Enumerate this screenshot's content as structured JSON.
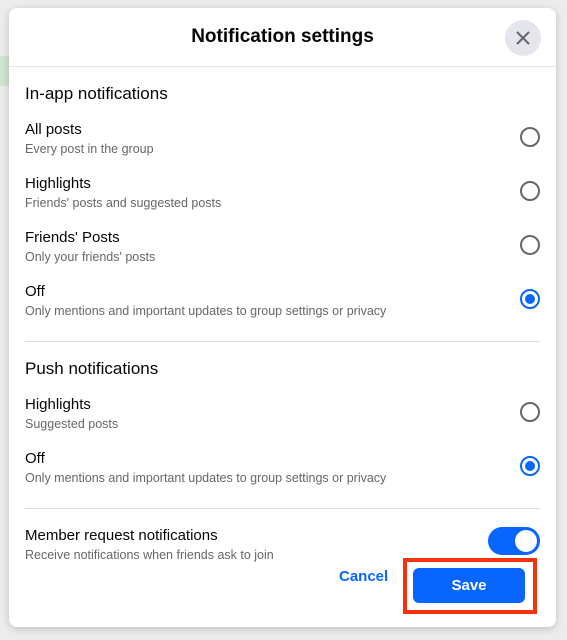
{
  "dialog": {
    "title": "Notification settings"
  },
  "in_app": {
    "title": "In-app notifications",
    "options": [
      {
        "label": "All posts",
        "desc": "Every post in the group",
        "selected": false
      },
      {
        "label": "Highlights",
        "desc": "Friends' posts and suggested posts",
        "selected": false
      },
      {
        "label": "Friends' Posts",
        "desc": "Only your friends' posts",
        "selected": false
      },
      {
        "label": "Off",
        "desc": "Only mentions and important updates to group settings or privacy",
        "selected": true
      }
    ]
  },
  "push": {
    "title": "Push notifications",
    "options": [
      {
        "label": "Highlights",
        "desc": "Suggested posts",
        "selected": false
      },
      {
        "label": "Off",
        "desc": "Only mentions and important updates to group settings or privacy",
        "selected": true
      }
    ]
  },
  "member": {
    "label": "Member request notifications",
    "desc": "Receive notifications when friends ask to join",
    "enabled": true
  },
  "actions": {
    "cancel": "Cancel",
    "save": "Save"
  },
  "colors": {
    "accent": "#0866ff",
    "highlight": "#f2330c"
  }
}
